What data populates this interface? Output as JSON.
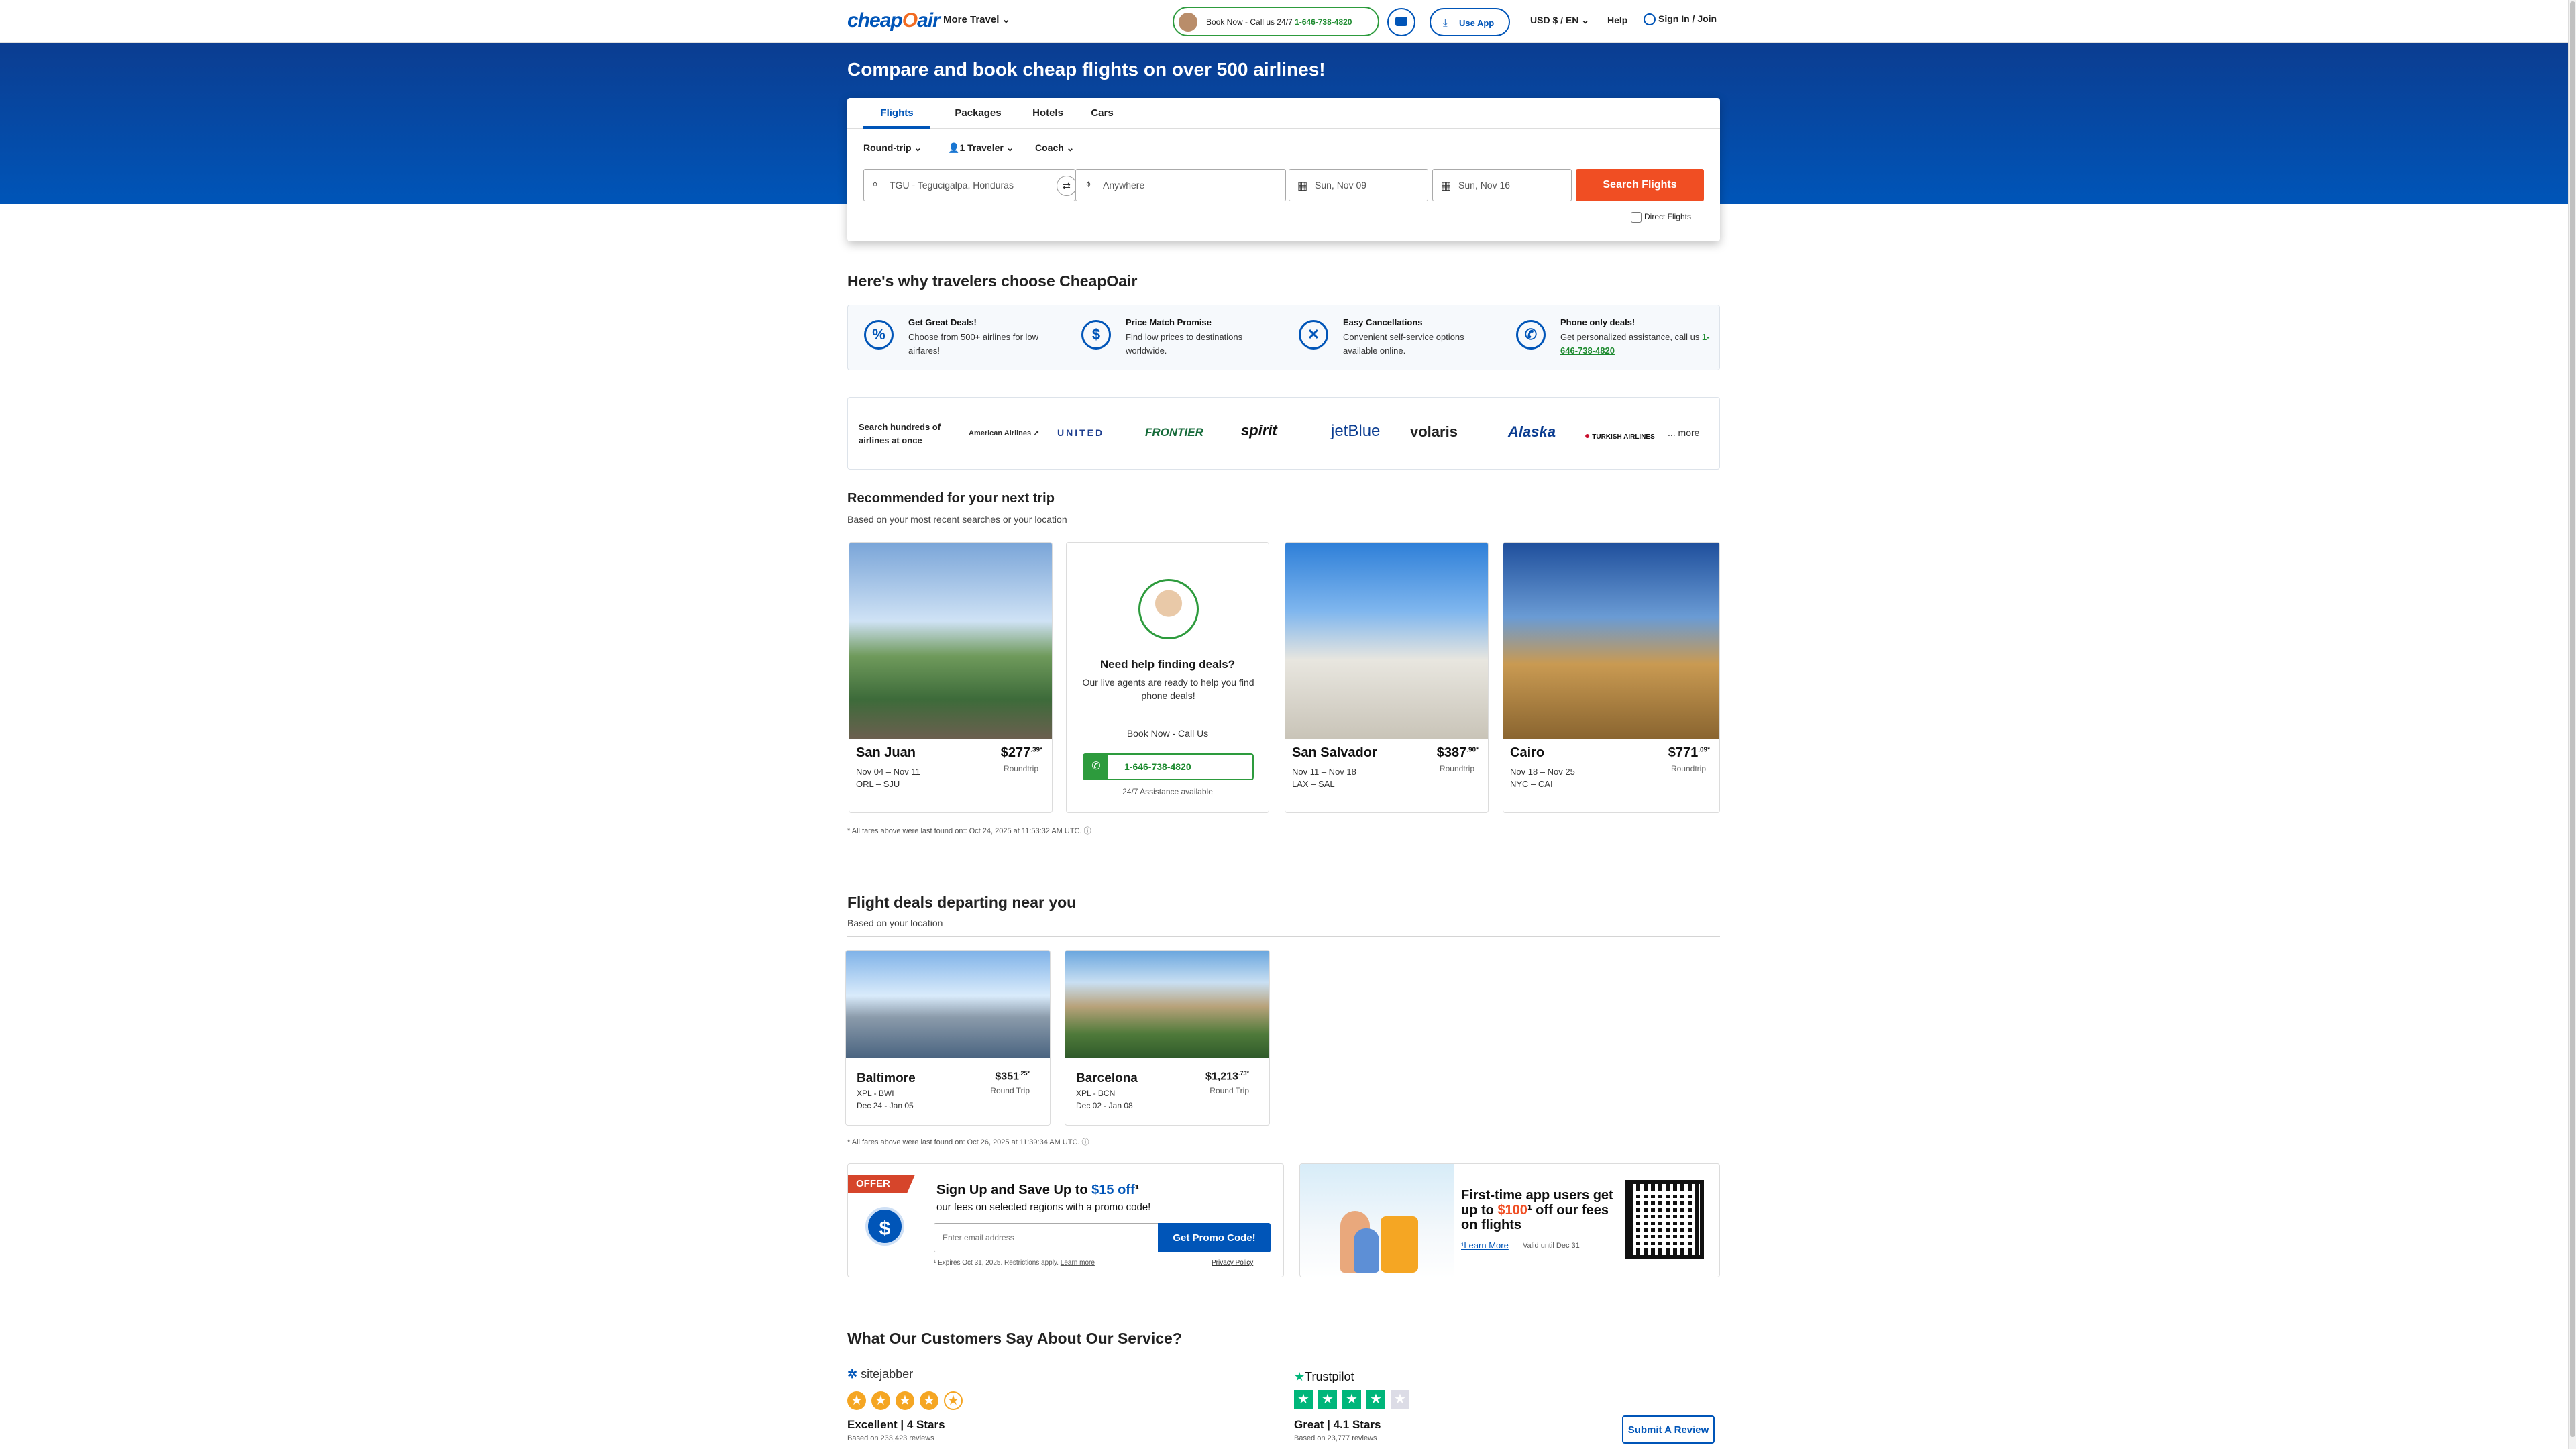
{
  "header": {
    "logo_main": "cheap",
    "logo_o": "O",
    "logo_end": "air",
    "more_travel": "More Travel ⌄",
    "book_now_text": "Book Now - Call us 24/7 ",
    "book_now_phone": "1-646-738-4820",
    "use_app": "Use App",
    "currency": "USD $ / EN ⌄",
    "help": "Help",
    "sign_in": "Sign In / Join"
  },
  "hero": {
    "title": "Compare and book cheap flights on over 500 airlines!"
  },
  "search": {
    "tabs": [
      "Flights",
      "Packages",
      "Hotels",
      "Cars"
    ],
    "trip_type": "Round-trip ⌄",
    "travelers": "1 Traveler ⌄",
    "cabin": "Coach ⌄",
    "origin": "TGU - Tegucigalpa, Honduras",
    "destination": "Anywhere",
    "depart": "Sun, Nov 09",
    "return": "Sun, Nov 16",
    "search_button": "Search Flights",
    "direct": "Direct Flights"
  },
  "why": {
    "title": "Here's why travelers choose CheapOair",
    "items": [
      {
        "title": "Get Great Deals!",
        "desc": "Choose from 500+ airlines for low airfares!",
        "icon": "%"
      },
      {
        "title": "Price Match Promise",
        "desc": "Find low prices to destinations worldwide.",
        "icon": "$"
      },
      {
        "title": "Easy Cancellations",
        "desc": "Convenient self-service options available online.",
        "icon": "✕"
      },
      {
        "title": "Phone only deals!",
        "desc": "Get personalized assistance, call us",
        "phone": "1-646-738-4820",
        "icon": "✆"
      }
    ]
  },
  "airlines": {
    "label": "Search hundreds of airlines at once",
    "list": [
      "American Airlines ↗",
      "UNITED",
      "FRONTIER",
      "spirit",
      "jetBlue",
      "volaris",
      "Alaska",
      "TURKISH AIRLINES"
    ],
    "more": "... more"
  },
  "recommended": {
    "title": "Recommended for your next trip",
    "subtitle": "Based on your most recent searches or your location",
    "cards": [
      {
        "city": "San Juan",
        "price": "$277",
        "cents": ".39*",
        "rt": "Roundtrip",
        "dates": "Nov 04 – Nov 11",
        "route": "ORL – SJU"
      },
      {
        "city": "San Salvador",
        "price": "$387",
        "cents": ".90*",
        "rt": "Roundtrip",
        "dates": "Nov 11 – Nov 18",
        "route": "LAX – SAL"
      },
      {
        "city": "Cairo",
        "price": "$771",
        "cents": ".09*",
        "rt": "Roundtrip",
        "dates": "Nov 18 – Nov 25",
        "route": "NYC – CAI"
      }
    ],
    "help": {
      "title": "Need help finding deals?",
      "desc": "Our live agents are ready to help you find phone deals!",
      "book_now": "Book Now - Call Us",
      "phone": "1-646-738-4820",
      "avail": "24/7 Assistance available"
    },
    "note": "* All fares above were last found on:: Oct 24, 2025 at 11:53:32 AM UTC. ⓘ"
  },
  "deals": {
    "title": "Flight deals departing near you",
    "subtitle": "Based on your location",
    "cards": [
      {
        "city": "Baltimore",
        "code": "XPL - BWI",
        "dates": "Dec 24 - Jan 05",
        "price": "$351",
        "cents": ".25*",
        "rt": "Round Trip"
      },
      {
        "city": "Barcelona",
        "code": "XPL - BCN",
        "dates": "Dec 02 - Jan 08",
        "price": "$1,213",
        "cents": ".73*",
        "rt": "Round Trip"
      }
    ],
    "note": "* All fares above were last found on: Oct 26, 2025 at 11:39:34 AM UTC. ⓘ"
  },
  "offer": {
    "tag": "OFFER",
    "title_a": "Sign Up and Save Up to ",
    "title_b": "$15 off",
    "title_c": "¹",
    "desc": "our fees on selected regions with a promo code!",
    "email_placeholder": "Enter email address",
    "promo_button": "Get Promo Code!",
    "expires": "¹ Expires Oct 31, 2025. Restrictions apply. ",
    "learn_more": "Learn more",
    "privacy": "Privacy Policy"
  },
  "app": {
    "title_a": "First-time app users get up to ",
    "title_b": "$100",
    "title_c": "¹ off our fees on flights",
    "learn_more": "¹Learn More",
    "valid": "Valid until Dec 31"
  },
  "reviews": {
    "title": "What Our Customers Say About Our Service?",
    "sitejabber": {
      "logo": "sitejabber",
      "rating": "Excellent | 4 Stars",
      "count": "Based on 233,423 reviews"
    },
    "trustpilot": {
      "logo": "Trustpilot",
      "rating": "Great | 4.1 Stars",
      "count": "Based on 23,777 reviews"
    },
    "submit": "Submit A Review"
  }
}
